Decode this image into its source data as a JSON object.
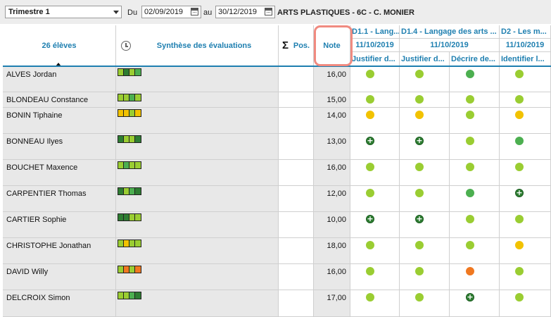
{
  "toolbar": {
    "period": "Trimestre 1",
    "from_label": "Du",
    "date_from": "02/09/2019",
    "to_label": "au",
    "date_to": "30/12/2019",
    "class_title": "ARTS PLASTIQUES - 6C - C. MONIER"
  },
  "headers": {
    "students": "26 élèves",
    "synthesis": "Synthèse des évaluations",
    "position": "Pos.",
    "note": "Note",
    "skills": [
      {
        "title": "D1.1 - Lang...",
        "date": "11/10/2019",
        "sub": "Justifier d..."
      },
      {
        "title": "D1.4 - Langage des arts ...",
        "date": "11/10/2019",
        "sub": "Justifier d..."
      },
      {
        "title": "",
        "date": "",
        "sub": "Décrire de..."
      },
      {
        "title": "D2 - Les m...",
        "date": "11/10/2019",
        "sub": "Identifier l..."
      }
    ]
  },
  "colors": {
    "accent": "#1e7fb0",
    "dark_green": "#2e7d32",
    "light_green": "#9acd32",
    "mid_green": "#4caf50",
    "yellow": "#f2c200",
    "orange": "#f07820"
  },
  "students": [
    {
      "name": "ALVES Jordan",
      "note": "16,00",
      "synth": [
        "#9acd32",
        "#2e7d32",
        "#9acd32",
        "#4caf50"
      ],
      "marks": [
        "light",
        "light",
        "mid",
        "light"
      ]
    },
    {
      "name": "BLONDEAU Constance",
      "note": "15,00",
      "synth": [
        "#9acd32",
        "#9acd32",
        "#4caf50",
        "#9acd32"
      ],
      "marks": [
        "light",
        "light",
        "light",
        "light"
      ]
    },
    {
      "name": "BONIN Tiphaine",
      "note": "14,00",
      "synth": [
        "#f2c200",
        "#f2c200",
        "#9acd32",
        "#f2c200"
      ],
      "marks": [
        "yellow",
        "yellow",
        "light",
        "yellow"
      ]
    },
    {
      "name": "BONNEAU Ilyes",
      "note": "13,00",
      "synth": [
        "#2e7d32",
        "#9acd32",
        "#9acd32",
        "#2e7d32"
      ],
      "marks": [
        "plus",
        "plus",
        "light",
        "mid"
      ]
    },
    {
      "name": "BOUCHET Maxence",
      "note": "16,00",
      "synth": [
        "#9acd32",
        "#4caf50",
        "#9acd32",
        "#9acd32"
      ],
      "marks": [
        "light",
        "light",
        "light",
        "light"
      ]
    },
    {
      "name": "CARPENTIER Thomas",
      "note": "12,00",
      "synth": [
        "#2e7d32",
        "#9acd32",
        "#4caf50",
        "#2e7d32"
      ],
      "marks": [
        "light",
        "light",
        "mid",
        "plus"
      ]
    },
    {
      "name": "CARTIER Sophie",
      "note": "10,00",
      "synth": [
        "#2e7d32",
        "#2e7d32",
        "#9acd32",
        "#9acd32"
      ],
      "marks": [
        "plus",
        "plus",
        "light",
        "light"
      ]
    },
    {
      "name": "CHRISTOPHE Jonathan",
      "note": "18,00",
      "synth": [
        "#9acd32",
        "#f2c200",
        "#9acd32",
        "#9acd32"
      ],
      "marks": [
        "light",
        "light",
        "light",
        "yellow"
      ]
    },
    {
      "name": "DAVID Willy",
      "note": "16,00",
      "synth": [
        "#9acd32",
        "#f07820",
        "#9acd32",
        "#f07820"
      ],
      "marks": [
        "light",
        "light",
        "orange",
        "light"
      ]
    },
    {
      "name": "DELCROIX Simon",
      "note": "17,00",
      "synth": [
        "#9acd32",
        "#9acd32",
        "#4caf50",
        "#2e7d32"
      ],
      "marks": [
        "light",
        "light",
        "plus",
        "light"
      ]
    }
  ]
}
